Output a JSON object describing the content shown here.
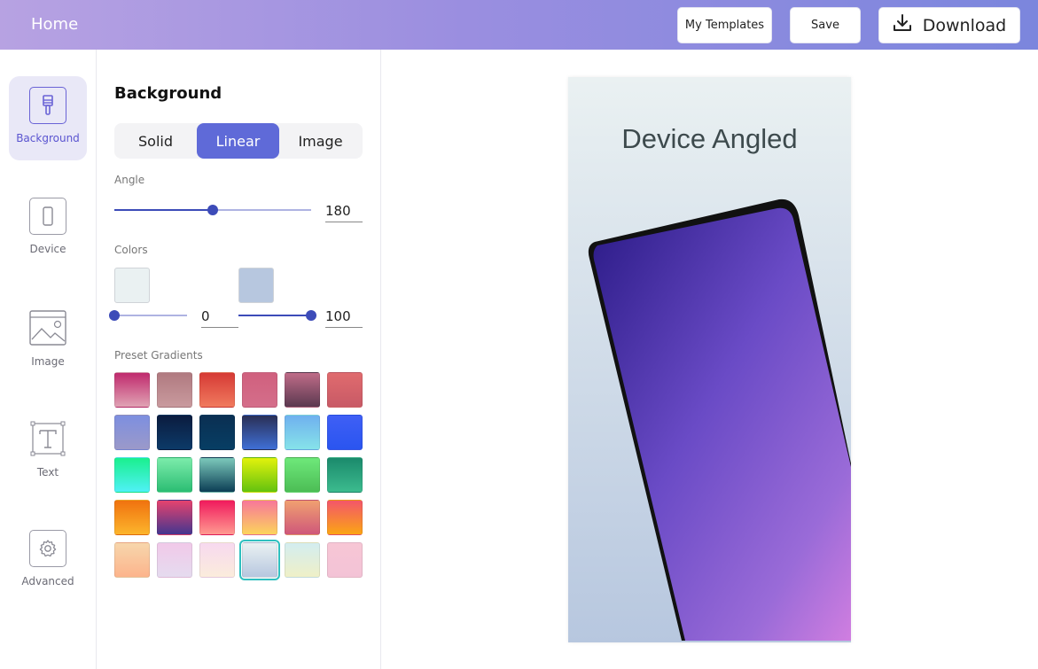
{
  "header": {
    "home_label": "Home",
    "templates_label": "My Templates",
    "save_label": "Save",
    "download_label": "Download"
  },
  "sidebar": {
    "items": [
      {
        "label": "Background",
        "icon": "brush-icon",
        "active": true
      },
      {
        "label": "Device",
        "icon": "phone-icon",
        "active": false
      },
      {
        "label": "Image",
        "icon": "image-icon",
        "active": false
      },
      {
        "label": "Text",
        "icon": "text-icon",
        "active": false
      },
      {
        "label": "Advanced",
        "icon": "gear-icon",
        "active": false
      }
    ]
  },
  "panel": {
    "title": "Background",
    "tabs": [
      "Solid",
      "Linear",
      "Image"
    ],
    "active_tab": "Linear",
    "angle_label": "Angle",
    "angle_value": "180",
    "angle_fraction": 0.5,
    "colors_label": "Colors",
    "color_stops": [
      {
        "color": "#eaf1f2",
        "value": "0",
        "fraction": 0.0
      },
      {
        "color": "#b7c7df",
        "value": "100",
        "fraction": 1.0
      }
    ],
    "presets_label": "Preset Gradients",
    "presets": [
      [
        "#c02a6d",
        "#e0a3b4"
      ],
      [
        "#b07a80",
        "#c99a9e"
      ],
      [
        "#d63a35",
        "#f07a5e"
      ],
      [
        "#d0607e",
        "#d46e8a"
      ],
      [
        "#bf6c88",
        "#5b3950"
      ],
      [
        "#e06b6e",
        "#c85a66"
      ],
      [
        "#7d8fe0",
        "#9b99c9"
      ],
      [
        "#0b1c3f",
        "#0c3a68"
      ],
      [
        "#0a2f52",
        "#073e64"
      ],
      [
        "#2a2f55",
        "#3f6fd6"
      ],
      [
        "#6fb0ef",
        "#86e3e9"
      ],
      [
        "#3f5ff5",
        "#2a55f0"
      ],
      [
        "#1af08e",
        "#4ff1f6"
      ],
      [
        "#7cecab",
        "#2bbd73"
      ],
      [
        "#7cc9bb",
        "#0c3e55"
      ],
      [
        "#e2f20c",
        "#63c20f"
      ],
      [
        "#6ee87a",
        "#4cbd55"
      ],
      [
        "#1b8a6c",
        "#3cbb8e"
      ],
      [
        "#f0720f",
        "#fcb52c"
      ],
      [
        "#e6436e",
        "#44368f"
      ],
      [
        "#f01a5d",
        "#ff9a90"
      ],
      [
        "#f7779a",
        "#fcd45c"
      ],
      [
        "#f0a070",
        "#cf577a"
      ],
      [
        "#f3566a",
        "#fba514"
      ],
      [
        "#f7d6ac",
        "#fcb48c"
      ],
      [
        "#f1c9e9",
        "#e5dbef"
      ],
      [
        "#f7d9ef",
        "#fbecdc"
      ],
      [
        "#eaf1f2",
        "#b7c7df"
      ],
      [
        "#d3edf0",
        "#eff0c7"
      ],
      [
        "#f7c6d5",
        "#f3c3d6"
      ]
    ],
    "selected_preset": 27
  },
  "canvas": {
    "title": "Device Angled",
    "bg_colors": [
      "#eaf1f2",
      "#b7c7df"
    ]
  }
}
